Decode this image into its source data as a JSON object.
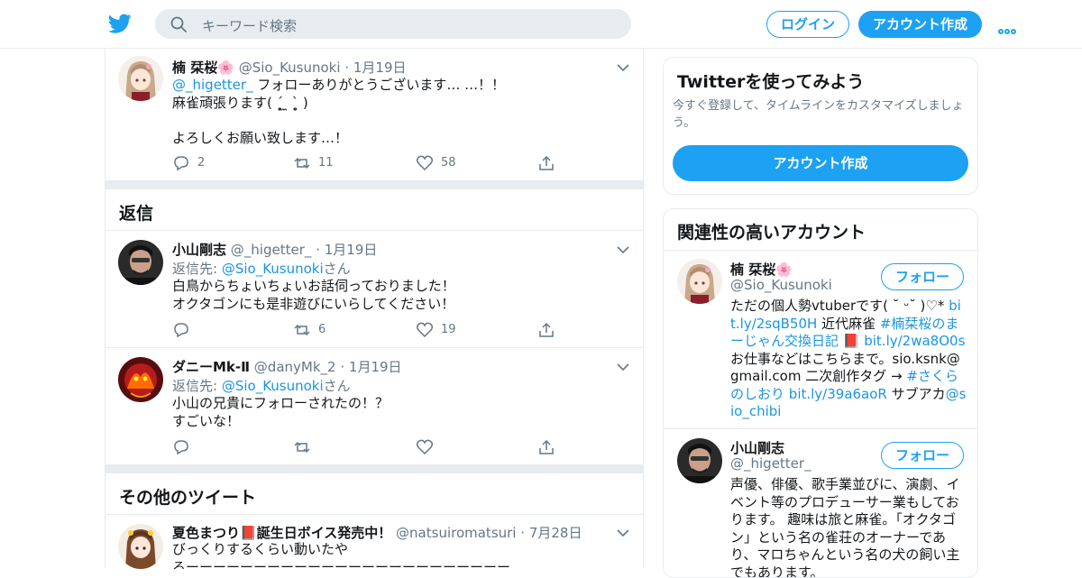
{
  "topbar": {
    "search_placeholder": "キーワード検索",
    "login_label": "ログイン",
    "signup_label": "アカウント作成"
  },
  "main": {
    "tweet1": {
      "name": "楠 栞桜",
      "name_emoji": "🌸",
      "handle": "@Sio_Kusunoki",
      "time": "1月19日",
      "mention": "@_higetter_",
      "line1": " フォローありがとうございます… …！！",
      "line2": "麻雀頑張ります( ˊ̥̥̥̥̥̥̥̥̥̥ ̼ ˋ̥̥̥̥̥̥̥̥̥̥ )",
      "line3": "",
      "line4": "よろしくお願い致します…！",
      "replies": "2",
      "retweets": "11",
      "likes": "58"
    },
    "replies_title": "返信",
    "reply1": {
      "name": "小山剛志",
      "handle": "@_higetter_",
      "time": "1月19日",
      "reply_prefix": "返信先: ",
      "reply_to": "@Sio_Kusunoki",
      "reply_suffix": "さん",
      "line1": "白鳥からちょいちょいお話伺っておりました！",
      "line2": "オクタゴンにも是非遊びにいらしてください！",
      "replies": "",
      "retweets": "6",
      "likes": "19"
    },
    "reply2": {
      "name": "ダニーMk-Ⅱ",
      "handle": "@danyMk_2",
      "time": "1月19日",
      "reply_prefix": "返信先: ",
      "reply_to": "@Sio_Kusunoki",
      "reply_suffix": "さん",
      "line1": "小山の兄貴にフォローされたの！？",
      "line2": "すごいな！",
      "replies": "",
      "retweets": "",
      "likes": ""
    },
    "other_title": "その他のツイート",
    "tweet_other": {
      "name": "夏色まつり",
      "name_mid": "📕",
      "name_rest": "誕生日ボイス発売中！",
      "handle": "@natsuiromatsuri",
      "time": "7月28日",
      "line1": "びっくりするくらい動いたや",
      "line2": "ろーーーーーーーーーーーーーーーーーーーーーーーー"
    }
  },
  "sidebar": {
    "try_title": "Twitterを使ってみよう",
    "try_sub": "今すぐ登録して、タイムラインをカスタマイズしましょう。",
    "signup_label": "アカウント作成",
    "related_title": "関連性の高いアカウント",
    "follow_label": "フォロー",
    "acct1": {
      "name": "楠 栞桜",
      "name_emoji": "🌸",
      "handle": "@Sio_Kusunoki",
      "bio_1": "ただの個人勢vtuberです( ˘ ᵕ˘ )♡*",
      "bio_link1": "bit.ly/2sqB50H",
      "bio_2": " 近代麻雀 ",
      "bio_tag1": "#楠栞桜のまーじゃん交換日記",
      "bio_book": " 📕 ",
      "bio_link2": "bit.ly/2wa8O0s",
      "bio_3": " お仕事などはこちらまで。sio.ksnk@gmail.com 二次創作タグ → ",
      "bio_tag2": "#さくらのしおり",
      "bio_4": " ",
      "bio_link3": "bit.ly/39a6aoR",
      "bio_5": " サブアカ",
      "bio_link4": "@sio_chibi"
    },
    "acct2": {
      "name": "小山剛志",
      "handle": "@_higetter_",
      "bio": "声優、俳優、歌手業並びに、演劇、イベント等のプロデューサー業もしております。 趣味は旅と麻雀。「オクタゴン」という名の雀荘のオーナーであり、マロちゃんという名の犬の飼い主でもあります。"
    }
  },
  "colors": {
    "accent": "#1da1f2",
    "link": "#1b95e0",
    "muted": "#657786",
    "divider": "#e6ecf0"
  }
}
